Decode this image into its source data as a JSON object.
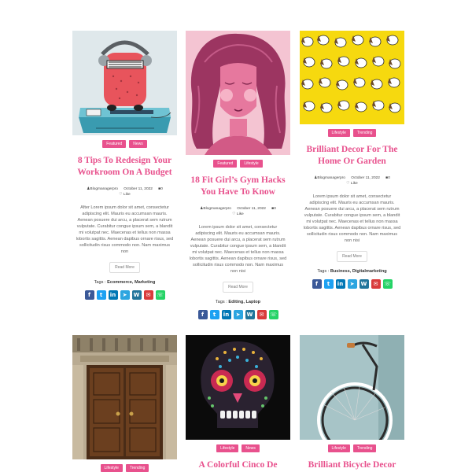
{
  "colors": {
    "accent": "#e8518d",
    "facebook": "#3b5998",
    "twitter": "#1da1f2",
    "linkedin": "#0077b5",
    "telegram": "#2ca5e0",
    "wordpress": "#21759b",
    "email": "#d93b3b",
    "whatsapp": "#25d366"
  },
  "social_icons": [
    "facebook-icon",
    "twitter-icon",
    "linkedin-icon",
    "telegram-icon",
    "wordpress-icon",
    "email-icon",
    "whatsapp-icon"
  ],
  "posts": [
    {
      "categories": [
        "Featured",
        "News"
      ],
      "title": "8 Tips To Redesign Your Workroom On A Budget",
      "author": "Blogmanagerpro",
      "date": "October 11, 2022",
      "comments": "0",
      "likes": "Like",
      "excerpt": "After Lorem ipsum dolor sit amet, consectetur adipiscing elit. Mauris eu accumsan mauris. Aenean posuere dui arcu, a placerat sem rutrum vulputate. Curabitur congue ipsum sem, a blandit mi volutpat nec. Maecenas et tellus non massa lobortis sagittis. Aenean dapibus ornare risus, sed sollicitudin risus commodo non. Nam maximus non",
      "read_more": "Read More",
      "tags_label": "Tags :",
      "tags": "Ecommerce, Marketing"
    },
    {
      "categories": [
        "Featured",
        "Lifestyle"
      ],
      "title": "18 Fit Girl’s Gym Hacks You Have To Know",
      "author": "Blogmanagerpro",
      "date": "October 11, 2022",
      "comments": "0",
      "likes": "Like",
      "excerpt": "Lorem ipsum dolor sit amet, consectetur adipiscing elit. Mauris eu accumsan mauris. Aenean posuere dui arcu, a placerat sem rutrum vulputate. Curabitur congue ipsum sem, a blandit mi volutpat nec. Maecenas et tellus non massa lobortis sagittis. Aenean dapibus ornare risus, sed sollicitudin risus commodo non. Nam maximus non nisi",
      "read_more": "Read More",
      "tags_label": "Tags :",
      "tags": "Editing, Laptop"
    },
    {
      "categories": [
        "Lifestyle",
        "Trending"
      ],
      "title": "Brilliant Decor For The Home Or Garden",
      "author": "Blogmanagerpro",
      "date": "October 11, 2022",
      "comments": "0",
      "likes": "Like",
      "excerpt": "Lorem ipsum dolor sit amet, consectetur adipiscing elit. Mauris eu accumsan mauris. Aenean posuere dui arcu, a placerat sem rutrum vulputate. Curabitur congue ipsum sem, a blandit mi volutpat nec. Maecenas et tellus non massa lobortis sagittis. Aenean dapibus ornare risus, sed sollicitudin risus commodo non. Nam maximus non nisi",
      "read_more": "Read More",
      "tags_label": "Tags :",
      "tags": "Business, Digitalmarketing"
    },
    {
      "categories": [
        "Lifestyle",
        "Trending"
      ]
    },
    {
      "categories": [
        "Lifestyle",
        "News"
      ],
      "title": "A Colorful Cinco De Mayo"
    },
    {
      "categories": [
        "Lifestyle",
        "Trending"
      ],
      "title": "Brilliant Bicycle Decor For"
    }
  ]
}
